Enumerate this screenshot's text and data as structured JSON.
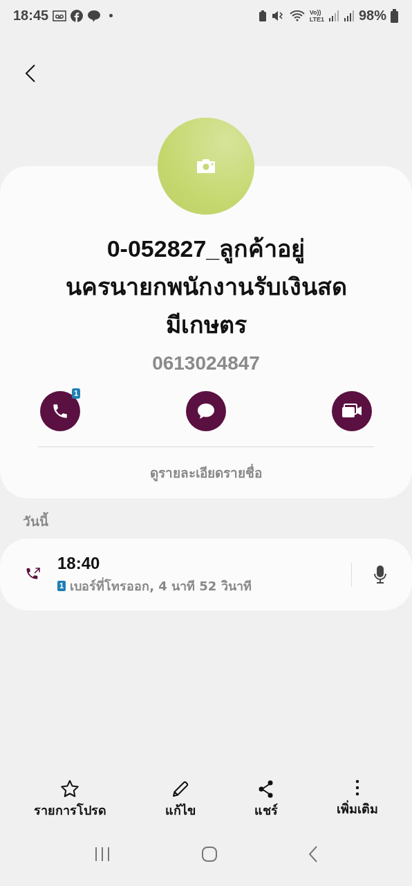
{
  "status_bar": {
    "time": "18:45",
    "volte": "Vo))",
    "network": "LTE1",
    "battery": "98%"
  },
  "contact": {
    "name": "0-052827_ลูกค้าอยู่นครนายกพนักงานรับเงินสดมีเกษตร",
    "phone": "0613024847",
    "actions": [
      {
        "kind": "call",
        "badge": "1"
      },
      {
        "kind": "message"
      },
      {
        "kind": "video"
      }
    ],
    "details_link": "ดูรายละเอียดรายชื่อ"
  },
  "history": {
    "heading": "วันนี้",
    "calls": [
      {
        "kind": "outgoing",
        "time": "18:40",
        "sim": "1",
        "detail": "เบอร์ที่โทรออก, 4 นาที 52 วินาที"
      }
    ]
  },
  "bottom_bar": [
    {
      "kind": "favorite",
      "label": "รายการโปรด"
    },
    {
      "kind": "edit",
      "label": "แก้ไข"
    },
    {
      "kind": "share",
      "label": "แชร์"
    },
    {
      "kind": "more",
      "label": "เพิ่มเติม"
    }
  ]
}
